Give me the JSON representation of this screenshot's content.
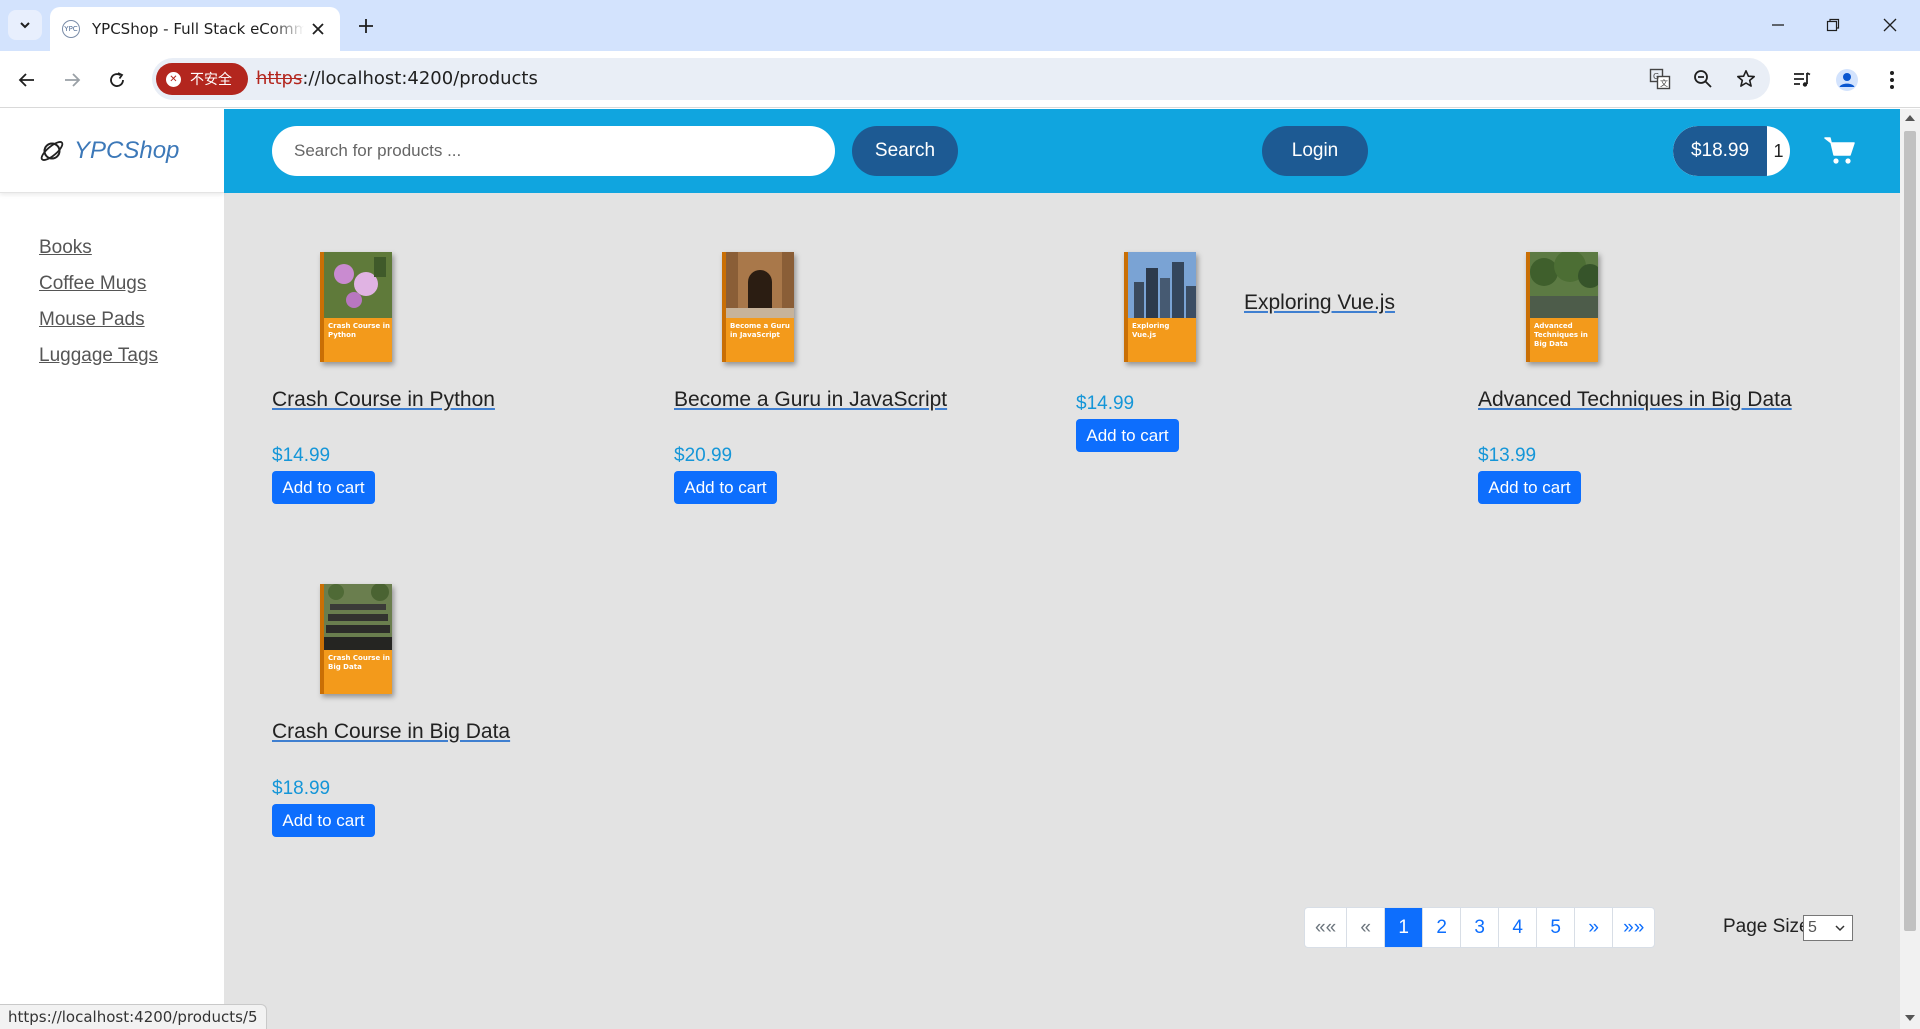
{
  "browser": {
    "tab_title": "YPCShop - Full Stack eCommerce",
    "tab_favicon_text": "YPC",
    "security_chip_label": "不安全",
    "url_scheme": "https",
    "url_rest": "://localhost:4200/products",
    "status_url": "https://localhost:4200/products/5"
  },
  "shop": {
    "brand": "YPCShop",
    "categories": [
      "Books",
      "Coffee Mugs",
      "Mouse Pads",
      "Luggage Tags"
    ],
    "search_placeholder": "Search for products ...",
    "search_label": "Search",
    "login_label": "Login",
    "cart_total": "$18.99",
    "cart_quantity": "1"
  },
  "products": [
    {
      "title": "Crash Course in Python",
      "cover_title": "Crash Course in Python",
      "price": "$14.99",
      "button": "Add to cart"
    },
    {
      "title": "Become a Guru in JavaScript",
      "cover_title": "Become a Guru in JavaScript",
      "price": "$20.99",
      "button": "Add to cart"
    },
    {
      "title": "Exploring Vue.js",
      "cover_title": "Exploring Vue.js",
      "price": "$14.99",
      "button": "Add to cart"
    },
    {
      "title": "Advanced Techniques in Big Data",
      "cover_title": "Advanced Techniques in Big Data",
      "price": "$13.99",
      "button": "Add to cart"
    },
    {
      "title": "Crash Course in Big Data",
      "cover_title": "Crash Course in Big Data",
      "price": "$18.99",
      "button": "Add to cart"
    }
  ],
  "pagination": {
    "first": "««",
    "prev": "«",
    "pages": [
      "1",
      "2",
      "3",
      "4",
      "5"
    ],
    "current": "1",
    "next": "»",
    "last": "»»",
    "page_size_label": "Page Size",
    "page_size_value": "5"
  },
  "colors": {
    "header": "#10a5df",
    "pill": "#1d5a93",
    "primary_button": "#0d6efd",
    "price": "#1596d8",
    "cover_orange": "#f39a1b",
    "insecure": "#b3261e"
  }
}
